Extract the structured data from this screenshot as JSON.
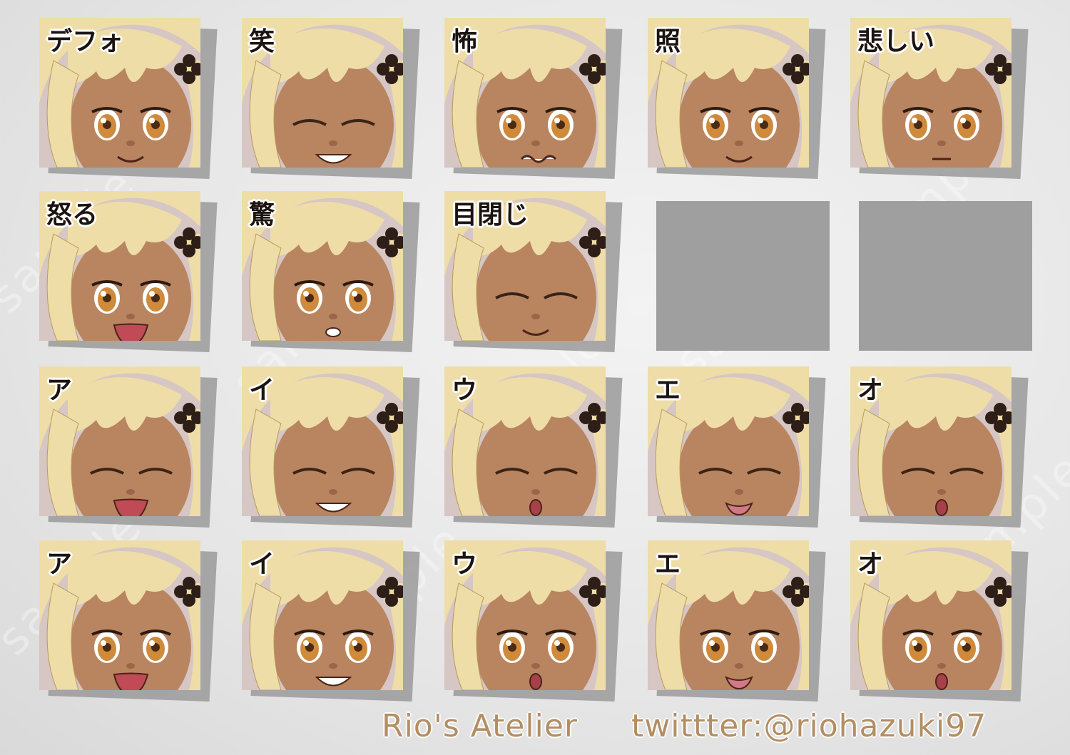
{
  "expressions": [
    {
      "label": "デフォ",
      "eyes": "open",
      "mouth": "smile"
    },
    {
      "label": "笑",
      "eyes": "closed",
      "mouth": "grin"
    },
    {
      "label": "怖",
      "eyes": "open",
      "mouth": "wavy"
    },
    {
      "label": "照",
      "eyes": "open",
      "mouth": "smile"
    },
    {
      "label": "悲しい",
      "eyes": "open",
      "mouth": "flat"
    },
    {
      "label": "怒る",
      "eyes": "open",
      "mouth": "open"
    },
    {
      "label": "驚",
      "eyes": "open",
      "mouth": "small"
    },
    {
      "label": "目閉じ",
      "eyes": "closed",
      "mouth": "smile"
    },
    {
      "label": "ア",
      "eyes": "closed",
      "mouth": "open"
    },
    {
      "label": "イ",
      "eyes": "closed",
      "mouth": "grin"
    },
    {
      "label": "ウ",
      "eyes": "closed",
      "mouth": "o"
    },
    {
      "label": "エ",
      "eyes": "closed",
      "mouth": "e"
    },
    {
      "label": "オ",
      "eyes": "closed",
      "mouth": "o"
    },
    {
      "label": "ア",
      "eyes": "open",
      "mouth": "open"
    },
    {
      "label": "イ",
      "eyes": "open",
      "mouth": "grin"
    },
    {
      "label": "ウ",
      "eyes": "open",
      "mouth": "o"
    },
    {
      "label": "エ",
      "eyes": "open",
      "mouth": "e"
    },
    {
      "label": "オ",
      "eyes": "open",
      "mouth": "o"
    }
  ],
  "watermark_text": "sample",
  "credits": {
    "atelier": "Rio's Atelier",
    "twitter": "twittter:@riohazuki97"
  },
  "colors": {
    "skin": "#b98560",
    "hair": "#efdda8",
    "eye": "#d08a3c",
    "blank": "#9f9f9f",
    "credit_text": "#b38e63"
  }
}
